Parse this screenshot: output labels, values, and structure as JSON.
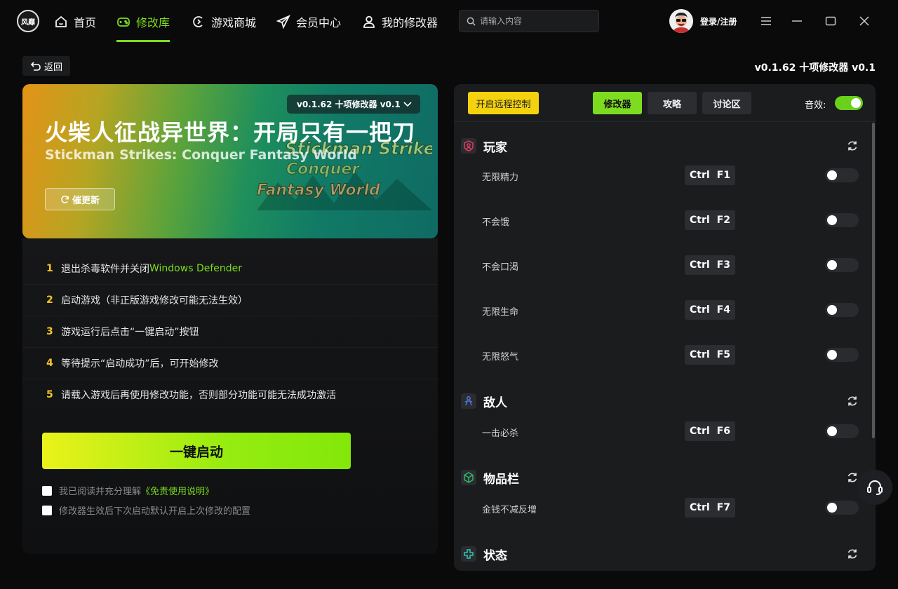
{
  "nav": {
    "logo_text": "风靡",
    "items": [
      {
        "label": "首页",
        "icon": "home-icon"
      },
      {
        "label": "修改库",
        "icon": "gamepad-icon"
      },
      {
        "label": "游戏商城",
        "icon": "store-icon"
      },
      {
        "label": "会员中心",
        "icon": "paper-plane-icon"
      },
      {
        "label": "我的修改器",
        "icon": "user-icon"
      }
    ],
    "active_item": "修改库",
    "search_placeholder": "请输入内容",
    "login_label": "登录/注册"
  },
  "colors": {
    "accent_green": "#7ddc1f",
    "accent_yellow": "#f5d20e",
    "step_number": "#f3c623",
    "background": "#0a0a0b",
    "panel": "#1b1c1e"
  },
  "header": {
    "back_label": "返回",
    "version_label": "v0.1.62 十项修改器 v0.1"
  },
  "banner": {
    "title": "火柴人征战异世界：开局只有一把刀",
    "subtitle": "Stickman Strikes: Conquer Fantasy World",
    "version_select": "v0.1.62 十项修改器 v0.1",
    "update_label": "催更新",
    "art_text": [
      "Stickman Strike",
      "Conquer",
      "Fantasy World"
    ]
  },
  "steps": [
    {
      "num": "1",
      "text": "退出杀毒软件并关闭 ",
      "highlight": "Windows Defender"
    },
    {
      "num": "2",
      "text": "启动游戏（非正版游戏修改可能无法生效）",
      "highlight": ""
    },
    {
      "num": "3",
      "text": "游戏运行后点击“一键启动”按钮",
      "highlight": ""
    },
    {
      "num": "4",
      "text": "等待提示“启动成功”后，可开始修改",
      "highlight": ""
    },
    {
      "num": "5",
      "text": "请载入游戏后再使用修改功能，否则部分功能可能无法成功激活",
      "highlight": ""
    }
  ],
  "launch_label": "一键启动",
  "checks": {
    "agree_text": "我已阅读并充分理解",
    "agree_link": "《免责使用说明》",
    "remember_text": "修改器生效后下次启动默认开启上次修改的配置"
  },
  "right": {
    "remote_label": "开启远程控制",
    "tabs": [
      "修改器",
      "攻略",
      "讨论区"
    ],
    "active_tab": "修改器",
    "sound_label": "音效:",
    "sound_on": true,
    "sections": [
      {
        "title": "玩家",
        "icon": "player-icon",
        "cheats": [
          {
            "name": "无限精力",
            "mod": "Ctrl",
            "key": "F1",
            "on": false
          },
          {
            "name": "不会饿",
            "mod": "Ctrl",
            "key": "F2",
            "on": false
          },
          {
            "name": "不会口渴",
            "mod": "Ctrl",
            "key": "F3",
            "on": false
          },
          {
            "name": "无限生命",
            "mod": "Ctrl",
            "key": "F4",
            "on": false
          },
          {
            "name": "无限怒气",
            "mod": "Ctrl",
            "key": "F5",
            "on": false
          }
        ]
      },
      {
        "title": "敌人",
        "icon": "enemy-icon",
        "cheats": [
          {
            "name": "一击必杀",
            "mod": "Ctrl",
            "key": "F6",
            "on": false
          }
        ]
      },
      {
        "title": "物品栏",
        "icon": "inventory-icon",
        "cheats": [
          {
            "name": "金钱不减反增",
            "mod": "Ctrl",
            "key": "F7",
            "on": false
          }
        ]
      },
      {
        "title": "状态",
        "icon": "status-icon",
        "cheats": []
      }
    ]
  }
}
